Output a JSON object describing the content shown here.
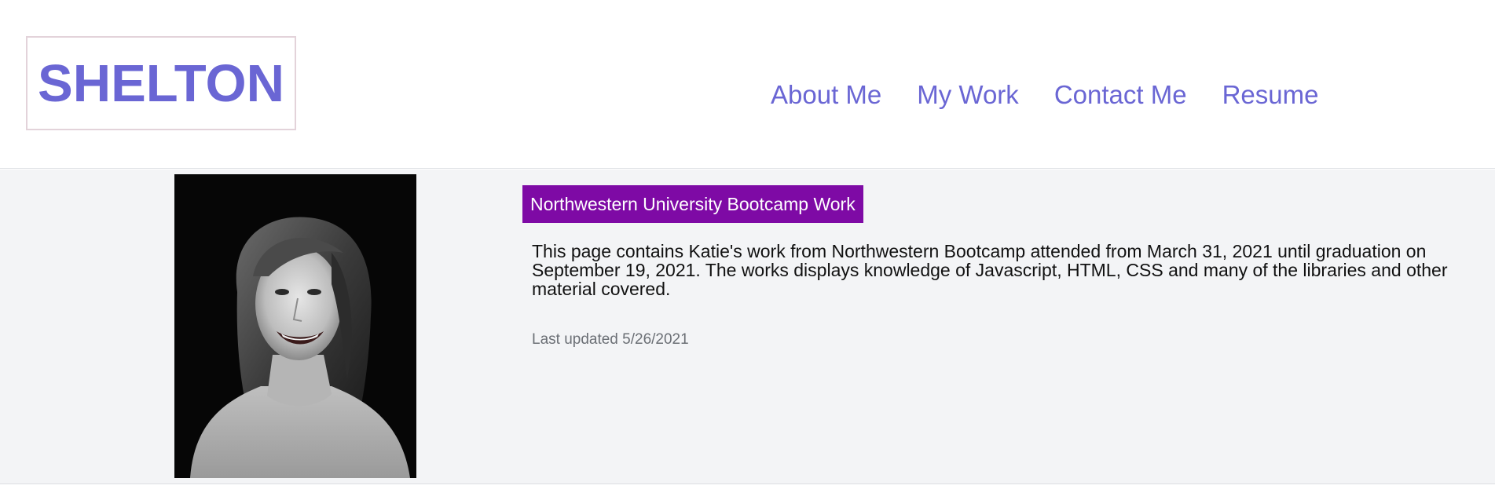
{
  "logo": {
    "text": "SHELTON"
  },
  "nav": {
    "items": [
      {
        "label": "About Me"
      },
      {
        "label": "My Work"
      },
      {
        "label": "Contact Me"
      },
      {
        "label": "Resume"
      }
    ]
  },
  "main": {
    "section_title": "Northwestern University Bootcamp Work",
    "description": "This page contains Katie's work from Northwestern Bootcamp attended from March 31, 2021 until graduation on September 19, 2021. The works displays knowledge of Javascript, HTML, CSS and many of the libraries and other material covered.",
    "last_updated": "Last updated 5/26/2021"
  },
  "colors": {
    "accent": "#6a66d4",
    "title_bg": "#7e0aa5",
    "main_bg": "#f3f4f6",
    "logo_border": "#e3d3da"
  }
}
